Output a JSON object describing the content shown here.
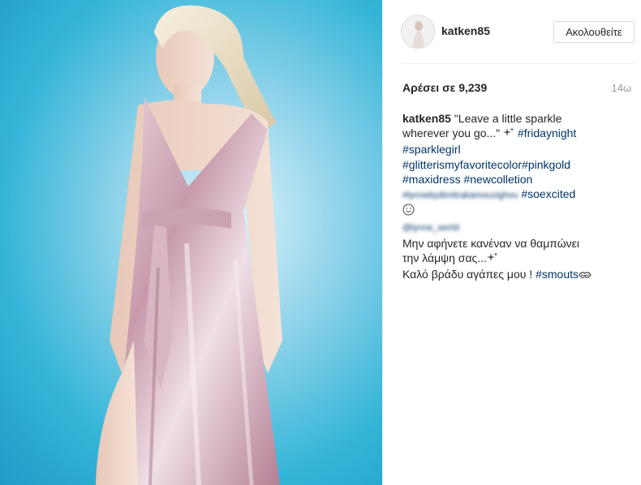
{
  "post": {
    "username": "katken85",
    "follow_label": "Ακολουθείτε",
    "likes_text": "Αρέσει σε 9,239",
    "time_ago": "14ω",
    "caption": {
      "user": "katken85",
      "line1": "\"Leave a little sparkle",
      "line2": "wherever you go...\"",
      "tag_fridaynight": "#fridaynight",
      "tag_sparklegirl": "#sparklegirl",
      "tag_glitter": "#glitterismyfavoritecolor",
      "tag_pinkgold": "#pinkgold",
      "tag_maxidress": "#maxidress",
      "tag_newcolletion": "#newcolletion",
      "blurred_mention": "#lynnebydimitrakamouzighou",
      "tag_soexcited": "#soexcited",
      "blurred_mention2": "@lynne_world",
      "greek_line1": "Μην αφήνετε κανέναν να θαμπώνει",
      "greek_line2": "την λάμψη σας...",
      "greek_line3": "Καλό βράδυ αγάπες μου !",
      "tag_smouts": "#smouts"
    },
    "colors": {
      "hashtag": "#003569",
      "text": "#262626",
      "muted": "#999999",
      "photo_background": "#34b5d8"
    },
    "icons": [
      "sparkles-icon",
      "smiley-icon",
      "kiss-icon"
    ]
  }
}
